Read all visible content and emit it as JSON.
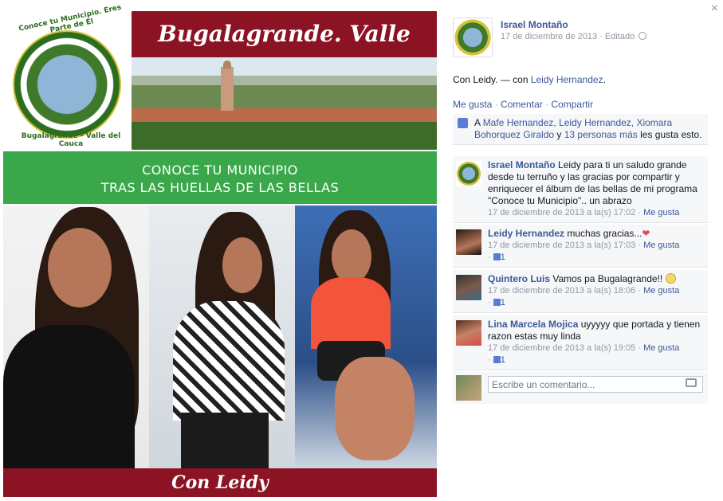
{
  "photo": {
    "logo_top": "Conoce tu Municipio. Eres Parte de Él",
    "logo_bottom": "Bugalagrande - Valle del Cauca",
    "banner_title": "Bugalagrande. Valle",
    "headline_1": "CONOCE TU MUNICIPIO",
    "headline_2": "TRAS LAS HUELLAS DE LAS BELLAS",
    "footer": "Con Leidy"
  },
  "post": {
    "close_icon": "×",
    "owner_name": "Israel Montaño",
    "date": "17 de diciembre de 2013",
    "edited": "Editado",
    "caption_text": "Con Leidy. — con ",
    "tagged": "Leidy Hernandez",
    "caption_end": ".",
    "actions": {
      "like": "Me gusta",
      "comment": "Comentar",
      "share": "Compartir",
      "sep": "·"
    },
    "likes": {
      "prefix": "A ",
      "names": "Mafe Hernandez, Leidy Hernandez, Xiomara Bohorquez Giraldo",
      "and": " y ",
      "more": "13 personas más",
      "suffix": " les gusta esto."
    }
  },
  "comments": [
    {
      "name": "Israel Montaño",
      "text": "Leidy para ti un saludo grande desde tu terruño y las gracias por compartir y enriquecer el álbum de las bellas de mi programa \"Conoce tu Municipio\".. un abrazo",
      "time": "17 de diciembre de 2013 a la(s) 17:02",
      "like": "Me gusta",
      "likes_count": ""
    },
    {
      "name": "Leidy Hernandez",
      "text": "muchas gracias...",
      "time": "17 de diciembre de 2013 a la(s) 17:03",
      "like": "Me gusta",
      "likes_count": "1"
    },
    {
      "name": "Quintero Luis",
      "text": "Vamos pa Bugalagrande!!",
      "time": "17 de diciembre de 2013 a la(s) 18:06",
      "like": "Me gusta",
      "likes_count": "1"
    },
    {
      "name": "Lina Marcela Mojica",
      "text": "uyyyyy que portada y tienen razon estas muy linda",
      "time": "17 de diciembre de 2013 a la(s) 19:05",
      "like": "Me gusta",
      "likes_count": "1"
    }
  ],
  "comment_box": {
    "placeholder": "Escribe un comentario..."
  },
  "colors": {
    "link": "#3b5998",
    "banner": "#8c1323",
    "green": "#3aa84a",
    "panel_bg": "#f6f7f9"
  },
  "icons": [
    "close-icon",
    "globe-icon",
    "like-thumb-icon",
    "heart-icon",
    "smiley-icon",
    "camera-icon"
  ]
}
